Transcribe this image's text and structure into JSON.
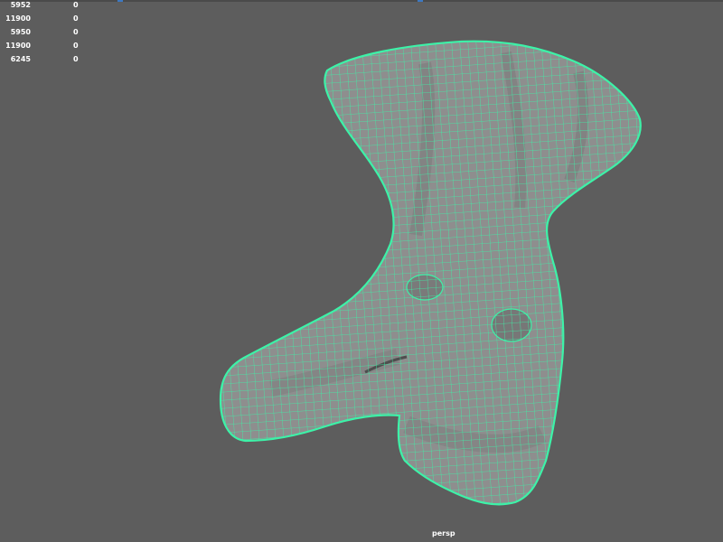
{
  "viewport": {
    "camera": "persp",
    "background_color": "#5d5d5d",
    "wire_color": "#3df2a8",
    "mesh_fill_color": "#8f8f8f"
  },
  "hud": {
    "rows": [
      {
        "count": "5952",
        "selected": "0"
      },
      {
        "count": "11900",
        "selected": "0"
      },
      {
        "count": "5950",
        "selected": "0"
      },
      {
        "count": "11900",
        "selected": "0"
      },
      {
        "count": "6245",
        "selected": "0"
      }
    ]
  }
}
